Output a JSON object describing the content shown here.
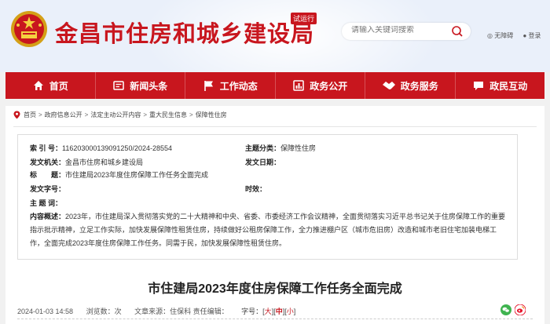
{
  "header": {
    "site_title": "金昌市住房和城乡建设局",
    "trial_badge": "试运行",
    "search_placeholder": "请输入关键词搜索",
    "links": [
      "无障碍",
      "登录"
    ]
  },
  "nav": {
    "items": [
      {
        "label": "首页",
        "icon": "home-icon"
      },
      {
        "label": "新闻头条",
        "icon": "news-icon"
      },
      {
        "label": "工作动态",
        "icon": "flag-icon"
      },
      {
        "label": "政务公开",
        "icon": "chart-icon"
      },
      {
        "label": "政务服务",
        "icon": "handshake-icon"
      },
      {
        "label": "政民互动",
        "icon": "chat-icon"
      }
    ]
  },
  "breadcrumb": [
    "首页",
    "政府信息公开",
    "法定主动公开内容",
    "重大民生信息",
    "保障性住房"
  ],
  "meta": {
    "index_label": "索 引 号：",
    "index_value": "116203000139091250/2024-28554",
    "category_label": "主题分类：",
    "category_value": "保障性住房",
    "issuer_label": "发文机关：",
    "issuer_value": "金昌市住房和城乡建设局",
    "date_label": "发文日期：",
    "date_value": "",
    "title_label": "标　　题：",
    "title_value": "市住建局2023年度住房保障工作任务全面完成",
    "docno_label": "发文字号：",
    "docno_value": "",
    "validity_label": "时效：",
    "validity_value": "",
    "keywords_label": "主 题 词：",
    "keywords_value": "",
    "summary_label": "内容概述：",
    "summary_value": "2023年，市住建局深入贯彻落实党的二十大精神和中央、省委、市委经济工作会议精神，全面贯彻落实习近平总书记关于住房保障工作的重要指示批示精神，立足工作实际，加快发展保障性租赁住房，持续做好公租房保障工作，全力推进棚户区（城市危旧房）改造和城市老旧住宅加装电梯工作，全面完成2023年度住房保障工作任务。同需于民，加快发展保障性租赁住房。"
  },
  "article": {
    "title": "市住建局2023年度住房保障工作任务全面完成",
    "date": "2024-01-03 14:58",
    "views_label": "浏览数：",
    "views_value": "次",
    "author": "文章来源：住保科  责任编辑：",
    "font_label": "字号：[",
    "font_sizes": [
      "大",
      "中",
      "小"
    ],
    "font_close": "]"
  },
  "colors": {
    "brand_red": "#c8161e",
    "header_bg": "#eaf0fa"
  }
}
